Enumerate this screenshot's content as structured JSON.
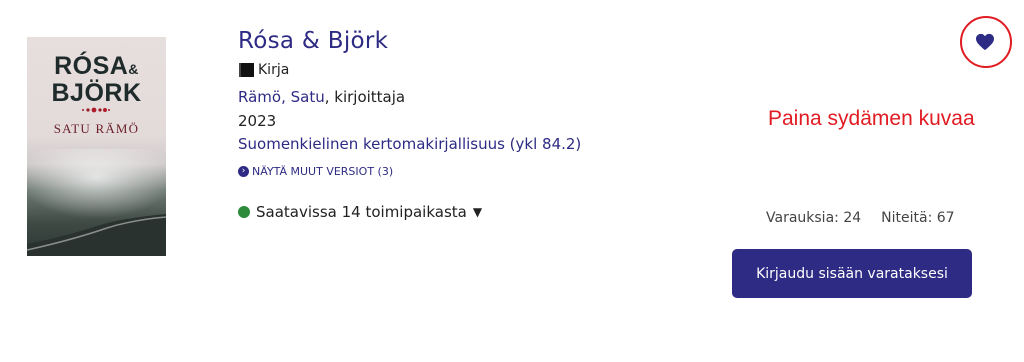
{
  "cover": {
    "title_line1": "RÓSA",
    "amp": "&",
    "title_line2": "BJÖRK",
    "author": "SATU RÄMÖ"
  },
  "record": {
    "title": "Rósa & Björk",
    "format_label": "Kirja",
    "author_name": "Rämö, Satu",
    "author_role": ", kirjoittaja",
    "year": "2023",
    "subject": "Suomenkielinen kertomakirjallisuus (ykl 84.2)",
    "versions_link": "NÄYTÄ MUUT VERSIOT (3)",
    "availability": "Saatavissa 14 toimipaikasta",
    "availability_caret": "▼"
  },
  "hint": "Paina sydämen kuvaa",
  "stats": {
    "reservations": "Varauksia: 24",
    "copies": "Niteitä: 67"
  },
  "login_button": "Kirjaudu sisään varataksesi",
  "colors": {
    "accent": "#2e2b84",
    "highlight_red": "#e11b22",
    "available_green": "#2e8b3c"
  },
  "icons": {
    "format": "book-icon",
    "favorite": "heart-icon",
    "versions": "chevron-right-circle-icon"
  }
}
